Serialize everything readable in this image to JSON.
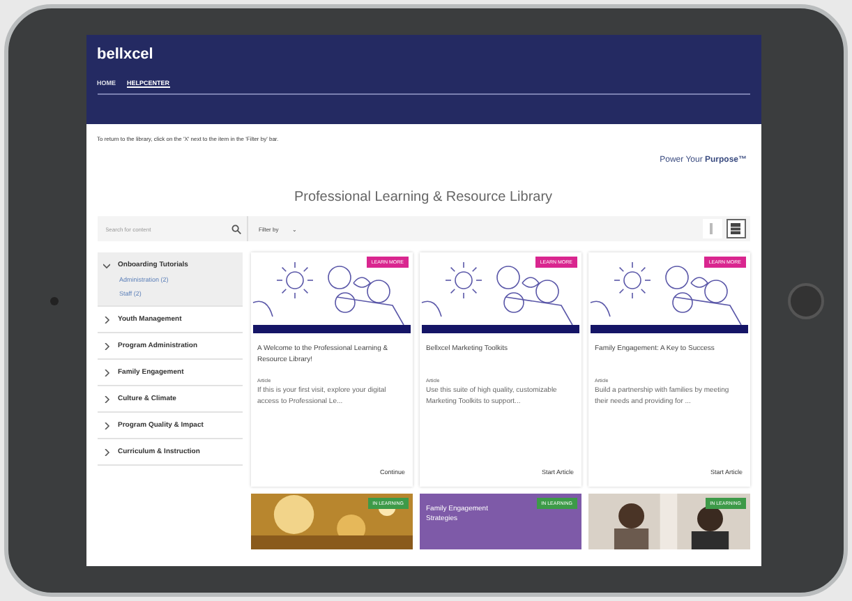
{
  "header": {
    "logo": "bellxcel",
    "nav": [
      {
        "label": "HOME",
        "selected": false
      },
      {
        "label": "HELPCENTER",
        "selected": true
      }
    ]
  },
  "notice": "To return to the library, click on the 'X' next to the item in the 'Filter by' bar.",
  "tagline": "Power Your **Purpose™**",
  "title": "Professional Learning & Resource Library",
  "search": {
    "placeholder": "Search for content"
  },
  "filter": {
    "label": "Filter by",
    "caret": "⌄"
  },
  "view": [
    {
      "kind": "list",
      "selected": false
    },
    {
      "kind": "grid",
      "selected": true
    }
  ],
  "sidebar": [
    {
      "label": "Onboarding Tutorials",
      "expanded": true,
      "children": [
        {
          "label": "Administration (2)"
        },
        {
          "label": "Staff (2)"
        }
      ]
    },
    {
      "label": "Youth Management",
      "expanded": false
    },
    {
      "label": "Program Administration",
      "expanded": false
    },
    {
      "label": "Family Engagement",
      "expanded": false
    },
    {
      "label": "Culture & Climate",
      "expanded": false
    },
    {
      "label": "Program Quality & Impact",
      "expanded": false
    },
    {
      "label": "Curriculum & Instruction",
      "expanded": false
    }
  ],
  "cards": [
    {
      "badge": "LEARN MORE",
      "title": "A Welcome to the Professional Learning & Resource Library!",
      "type": "Article",
      "description": "If this is your first visit, explore your digital access to Professional Le...",
      "action": "Continue"
    },
    {
      "badge": "LEARN MORE",
      "title": "Bellxcel Marketing Toolkits",
      "type": "Article",
      "description": "Use this suite of high quality, customizable Marketing Toolkits to support...",
      "action": "Start Article"
    },
    {
      "badge": "LEARN MORE",
      "title": "Family Engagement: A Key to Success",
      "type": "Article",
      "description": "Build a partnership with families by meeting their needs and providing for ...",
      "action": "Start Article"
    }
  ],
  "tiles": [
    {
      "kind": "picture",
      "badge": "IN LEARNING"
    },
    {
      "kind": "text",
      "badge": "IN LEARNING",
      "text": "Family Engagement Strategies"
    },
    {
      "kind": "picture",
      "badge": "IN LEARNING"
    }
  ]
}
